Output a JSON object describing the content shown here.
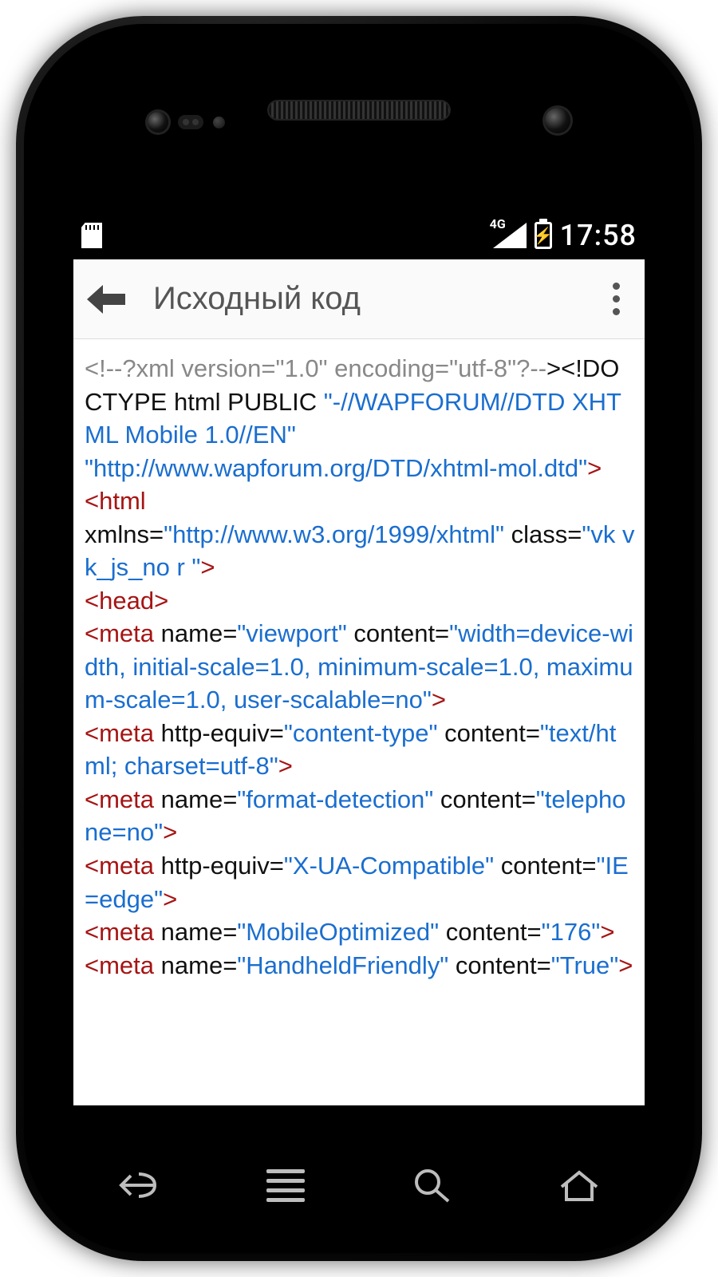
{
  "statusbar": {
    "network_label": "4G",
    "time": "17:58"
  },
  "appbar": {
    "title": "Исходный код"
  },
  "code": {
    "p1_comment": "<!--?xml version=\"1.0\" encoding=\"utf-8\"?--",
    "p1_black": "><!DOCTYPE html PUBLIC ",
    "p1_link1": "\"-//WAPFORUM//DTD XHTML Mobile 1.0//EN\"",
    "p1_link2": "\"http://www.wapforum.org/DTD/xhtml-mol.dtd\"",
    "gt": ">",
    "html_open": "<html",
    "html_xmlns_attr": " xmlns=",
    "html_xmlns_val": "\"http://www.w3.org/1999/xhtml\"",
    "html_class_attr": " class=",
    "html_class_val": "\"vk vk_js_no r \"",
    "head_open": " <head>",
    "m1_tag": "  <meta",
    "m1_name_attr": " name=",
    "m1_name_val": "\"viewport\"",
    "m1_content_attr": " content=",
    "m1_content_val": "\"width=device-width, initial-scale=1.0, minimum-scale=1.0, maximum-scale=1.0, user-scalable=no\"",
    "m2_tag": "  <meta",
    "m2_eq_attr": " http-equiv=",
    "m2_eq_val": "\"content-type\"",
    "m2_content_attr": " content=",
    "m2_content_val": "\"text/html; charset=utf-8\"",
    "m3_tag": "  <meta",
    "m3_name_attr": " name=",
    "m3_name_val": "\"format-detection\"",
    "m3_content_attr": " content=",
    "m3_content_val": "\"telephone=no\"",
    "m4_tag": "  <meta",
    "m4_eq_attr": " http-equiv=",
    "m4_eq_val": "\"X-UA-Compatible\"",
    "m4_content_attr": " content=",
    "m4_content_val": "\"IE=edge\"",
    "m5_tag": "  <meta",
    "m5_name_attr": " name=",
    "m5_name_val": "\"MobileOptimized\"",
    "m5_content_attr": " content=",
    "m5_content_val": "\"176\"",
    "m6_tag": "  <meta",
    "m6_name_attr": " name=",
    "m6_name_val": "\"HandheldFriendly\"",
    "m6_content_attr": " content=",
    "m6_content_val": "\"True\""
  }
}
